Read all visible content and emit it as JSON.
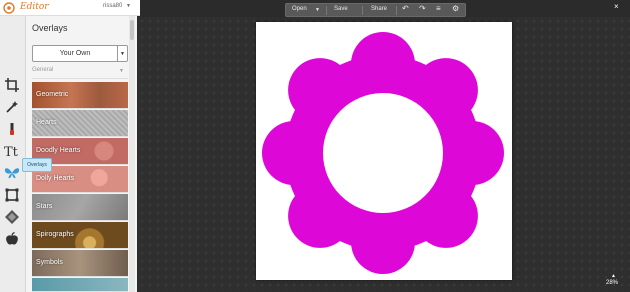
{
  "app": {
    "logo_text": "Editor",
    "username": "rissa80",
    "user_caret": "▼"
  },
  "tooltip": "Overlays",
  "panel": {
    "title": "Overlays",
    "select_label": "Your Own",
    "select_caret": "▼",
    "category": "General",
    "category_caret": "▼",
    "items": [
      {
        "label": "Geometric"
      },
      {
        "label": "Hearts"
      },
      {
        "label": "Doodly Hearts"
      },
      {
        "label": "Dolly Hearts"
      },
      {
        "label": "Stars"
      },
      {
        "label": "Spirographs"
      },
      {
        "label": "Symbols"
      }
    ]
  },
  "toolbar": {
    "open_label": "Open",
    "open_caret": "▼",
    "save_label": "Save",
    "share_label": "Share",
    "undo_icon": "↶",
    "redo_icon": "↷",
    "layers_icon": "≡",
    "settings_icon": "⚙"
  },
  "close_icon": "×",
  "zoom": {
    "caret": "▲",
    "level": "28%"
  },
  "colors": {
    "overlay_shape": "#dd07d8",
    "accent": "#e07a2a"
  },
  "icons": [
    "crop-icon",
    "magic-wand-icon",
    "brush-icon",
    "text-icon",
    "butterfly-icon",
    "frame-icon",
    "texture-icon",
    "apple-icon"
  ]
}
